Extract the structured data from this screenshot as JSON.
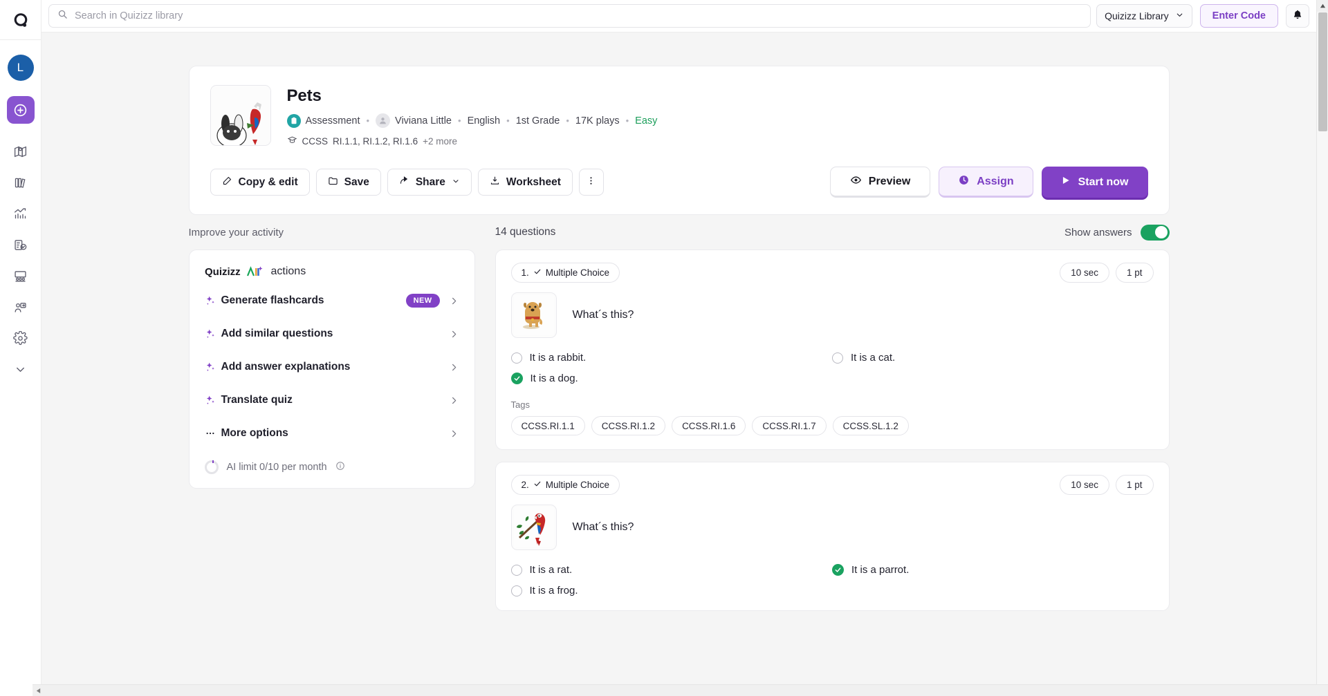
{
  "topbar": {
    "search_placeholder": "Search in Quizizz library",
    "search_value": "",
    "library_select": "Quizizz Library",
    "enter_code": "Enter Code"
  },
  "rail": {
    "avatar_initial": "L",
    "items": [
      {
        "name": "explore-icon"
      },
      {
        "name": "library-icon"
      },
      {
        "name": "reports-icon"
      },
      {
        "name": "assessments-icon"
      },
      {
        "name": "classes-icon"
      },
      {
        "name": "interactive-video-icon"
      },
      {
        "name": "settings-icon"
      },
      {
        "name": "expand-icon"
      }
    ]
  },
  "quiz": {
    "title": "Pets",
    "type": "Assessment",
    "author": "Viviana Little",
    "language": "English",
    "grade": "1st Grade",
    "plays": "17K plays",
    "difficulty": "Easy",
    "standards_label": "CCSS",
    "standards": "RI.1.1, RI.1.2, RI.1.6",
    "standards_more": "+2 more",
    "actions": {
      "copy_edit": "Copy & edit",
      "save": "Save",
      "share": "Share",
      "worksheet": "Worksheet",
      "more": "⋮",
      "preview": "Preview",
      "assign": "Assign",
      "start_now": "Start now"
    },
    "colors": {
      "primary": "#8141c6",
      "assign_text": "#7b3fc4",
      "assessment_badge": "#21a5a5",
      "difficulty": "#1b9e5a",
      "toggle_on": "#1aa260"
    }
  },
  "improve": {
    "heading": "Improve your activity",
    "ai_brand": "Quizizz AI",
    "ai_actions_label": "actions",
    "items": [
      {
        "label": "Generate flashcards",
        "badge": "NEW",
        "icon": "sparkle-icon"
      },
      {
        "label": "Add similar questions",
        "badge": "",
        "icon": "sparkle-icon"
      },
      {
        "label": "Add answer explanations",
        "badge": "",
        "icon": "sparkle-icon"
      },
      {
        "label": "Translate quiz",
        "badge": "",
        "icon": "sparkle-icon"
      },
      {
        "label": "More options",
        "badge": "",
        "icon": "ellipsis-icon"
      }
    ],
    "limit_text": "AI limit 0/10 per month"
  },
  "questions_panel": {
    "count_label": "14 questions",
    "show_answers_label": "Show answers",
    "show_answers_on": true,
    "tags_label": "Tags"
  },
  "questions": [
    {
      "number": "1.",
      "type": "Multiple Choice",
      "time": "10 sec",
      "points": "1 pt",
      "prompt": "What´s this?",
      "image": "dog",
      "options": [
        {
          "text": "It is a rabbit.",
          "correct": false
        },
        {
          "text": "It is a cat.",
          "correct": false
        },
        {
          "text": "It is a dog.",
          "correct": true
        }
      ],
      "tags": [
        "CCSS.RI.1.1",
        "CCSS.RI.1.2",
        "CCSS.RI.1.6",
        "CCSS.RI.1.7",
        "CCSS.SL.1.2"
      ]
    },
    {
      "number": "2.",
      "type": "Multiple Choice",
      "time": "10 sec",
      "points": "1 pt",
      "prompt": "What´s this?",
      "image": "parrot",
      "options": [
        {
          "text": "It is a rat.",
          "correct": false
        },
        {
          "text": "It is a parrot.",
          "correct": true
        },
        {
          "text": "It is a frog.",
          "correct": false
        }
      ],
      "tags": []
    }
  ]
}
